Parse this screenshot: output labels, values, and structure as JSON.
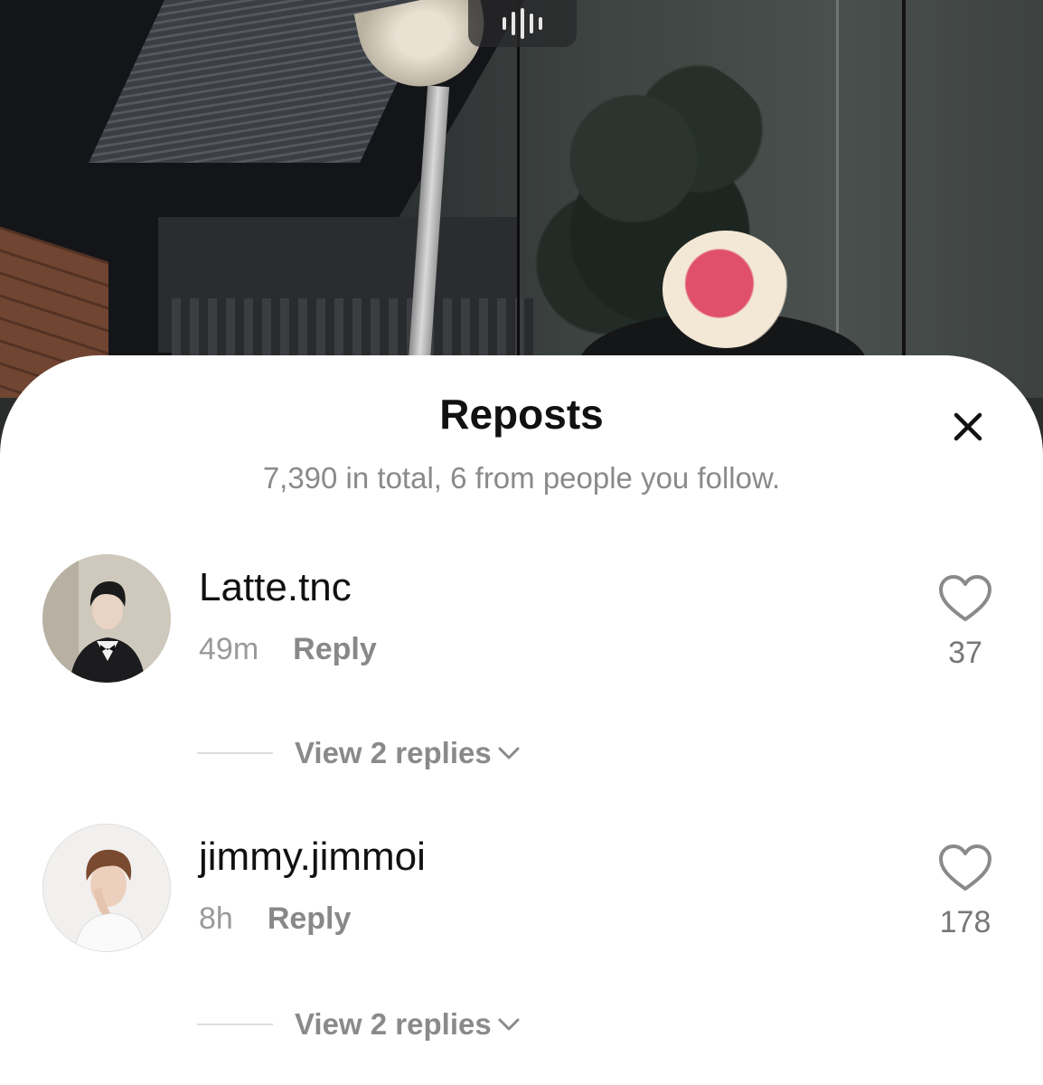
{
  "video": {
    "indicator_icon": "audio-bars-icon"
  },
  "sheet": {
    "title": "Reposts",
    "close_icon": "close-icon",
    "subtitle": "7,390 in total, 6 from people you follow.",
    "items": [
      {
        "username": "Latte.tnc",
        "time": "49m",
        "reply_label": "Reply",
        "like_count": "37",
        "replies_label": "View 2 replies"
      },
      {
        "username": "jimmy.jimmoi",
        "time": "8h",
        "reply_label": "Reply",
        "like_count": "178",
        "replies_label": "View 2 replies"
      }
    ]
  },
  "colors": {
    "sheet_bg": "#ffffff",
    "text_primary": "#111111",
    "text_secondary": "#8a8a8a"
  }
}
